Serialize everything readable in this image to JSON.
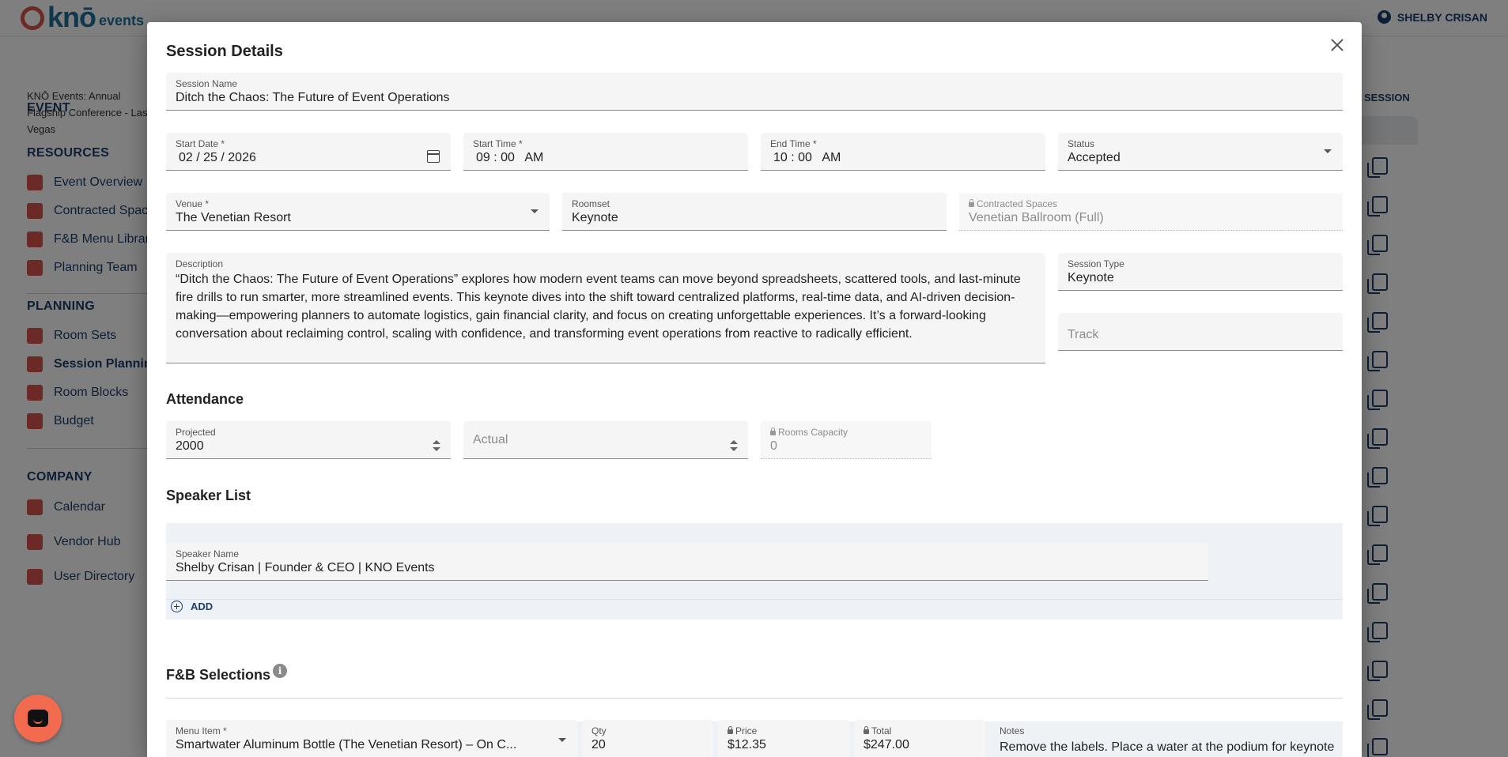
{
  "app": {
    "logo_text": "knō",
    "logo_sub": "events",
    "user_name": "SHELBY CRISAN"
  },
  "sidebar": {
    "event_title": "EVENT",
    "event_name": "KNŌ Events: Annual Flagship Conference - Las Vegas",
    "resources_title": "RESOURCES",
    "resources": [
      {
        "label": "Event Overview",
        "icon": "dashboard-icon"
      },
      {
        "label": "Contracted Spaces",
        "icon": "building-icon"
      },
      {
        "label": "F&B Menu Library",
        "icon": "utensils-icon"
      },
      {
        "label": "Planning Team",
        "icon": "team-icon"
      }
    ],
    "planning_title": "PLANNING",
    "planning": [
      {
        "label": "Room Sets",
        "icon": "roomset-icon"
      },
      {
        "label": "Session Planning",
        "icon": "calendar-icon",
        "active": true
      },
      {
        "label": "Room Blocks",
        "icon": "bed-icon"
      },
      {
        "label": "Budget",
        "icon": "dollar-icon"
      }
    ],
    "company_title": "COMPANY",
    "company": [
      {
        "label": "Calendar",
        "icon": "calendar-icon"
      },
      {
        "label": "Vendor Hub",
        "icon": "building-icon"
      },
      {
        "label": "User Directory",
        "icon": "user-icon"
      }
    ]
  },
  "main": {
    "add_session_label": "D SESSION"
  },
  "modal": {
    "title": "Session Details",
    "session_name": {
      "label": "Session Name",
      "value": "Ditch the Chaos: The Future of Event Operations"
    },
    "start_date": {
      "label": "Start Date *",
      "value": "02 / 25 / 2026"
    },
    "start_time": {
      "label": "Start Time *",
      "value": "09 : 00   AM"
    },
    "end_time": {
      "label": "End Time *",
      "value": "10 : 00   AM"
    },
    "status": {
      "label": "Status",
      "value": "Accepted"
    },
    "venue": {
      "label": "Venue *",
      "value": "The Venetian Resort"
    },
    "roomset": {
      "label": "Roomset",
      "value": "Keynote"
    },
    "contracted_spaces": {
      "label": "Contracted Spaces",
      "value": "Venetian Ballroom (Full)"
    },
    "description": {
      "label": "Description",
      "value": "“Ditch the Chaos: The Future of Event Operations” explores how modern event teams can move beyond spreadsheets, scattered tools, and last-minute fire drills to run smarter, more streamlined events. This keynote dives into the shift toward centralized platforms, real-time data, and AI-driven decision-making—empowering planners to automate logistics, gain financial clarity, and focus on creating unforgettable experiences. It’s a forward-looking conversation about reclaiming control, scaling with confidence, and transforming event operations from reactive to radically efficient."
    },
    "session_type": {
      "label": "Session Type",
      "value": "Keynote"
    },
    "track": {
      "placeholder": "Track"
    },
    "attendance_title": "Attendance",
    "projected": {
      "label": "Projected",
      "value": "2000"
    },
    "actual": {
      "placeholder": "Actual"
    },
    "rooms_capacity": {
      "label": "Rooms Capacity",
      "value": "0"
    },
    "speaker_title": "Speaker List",
    "speaker": {
      "label": "Speaker Name",
      "value": "Shelby Crisan | Founder & CEO | KNO Events"
    },
    "add_label": "ADD",
    "fb_title": "F&B Selections",
    "fb_row": {
      "menu_item_label": "Menu Item *",
      "menu_item_value": "Smartwater Aluminum Bottle (The Venetian Resort) – On C...",
      "qty_label": "Qty",
      "qty_value": "20",
      "price_label": "Price",
      "price_value": "$12.35",
      "total_label": "Total",
      "total_value": "$247.00",
      "notes_label": "Notes",
      "notes_value": "Remove the labels.  Place a water at the podium for keynote speakers."
    }
  }
}
